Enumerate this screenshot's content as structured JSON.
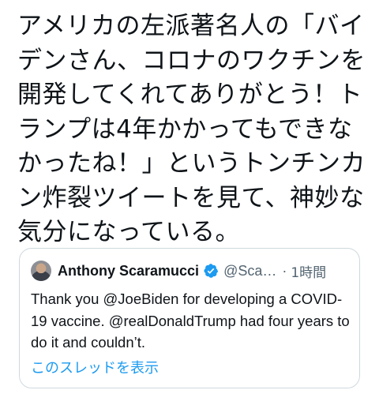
{
  "tweet": {
    "text": "アメリカの左派著名人の「バイ\nデンさん、コロナのワクチンを\n開発してくれてありがとう！ト\nランプは4年かかってもできな\nかったね！」というトンチンカ\nン炸裂ツイートを見て、神妙な\n気分になっている。"
  },
  "quote": {
    "author_name": "Anthony Scaramucci",
    "author_handle": "@Sca…",
    "separator": "·",
    "time": "1時間",
    "body": "Thank you @JoeBiden for developing a COVID-19 vaccine. @realDonaldTrump had four years to do it and couldn’t.",
    "show_thread": "このスレッドを表示",
    "verified_icon": "verified-badge-icon",
    "colors": {
      "link": "#1d9bf0",
      "secondary": "#536471",
      "border": "#cfd9de"
    }
  }
}
